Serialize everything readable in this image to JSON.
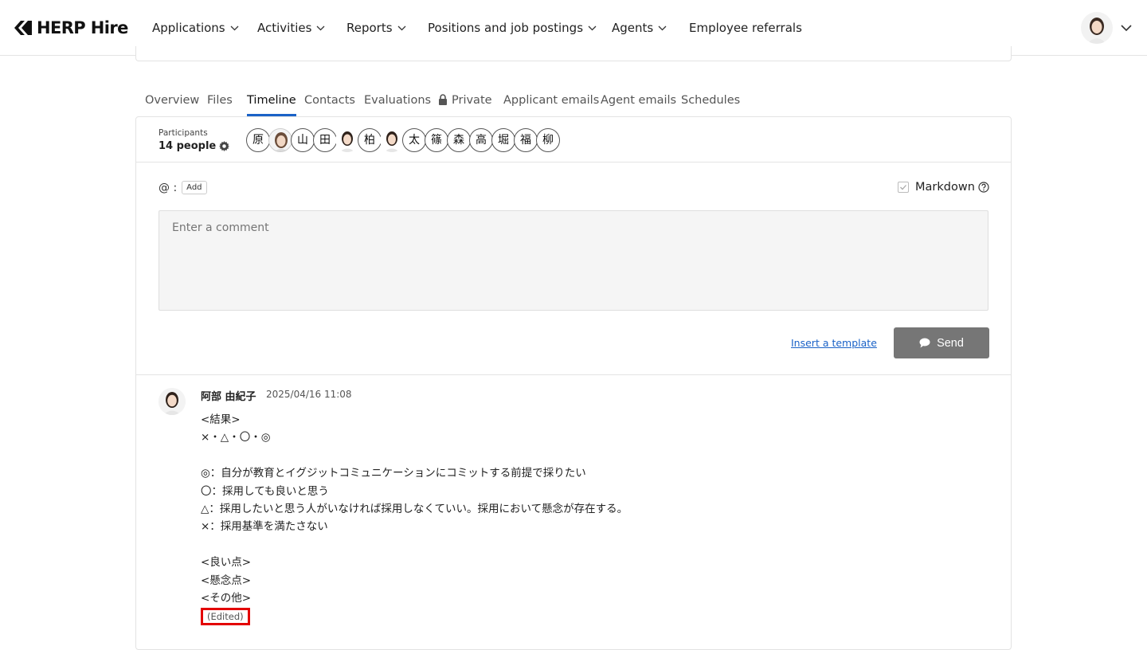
{
  "brand": {
    "name": "HERP Hire"
  },
  "nav": {
    "items": [
      {
        "label": "Applications",
        "dropdown": true,
        "active": true
      },
      {
        "label": "Activities",
        "dropdown": true
      },
      {
        "label": "Reports",
        "dropdown": true
      },
      {
        "label": "Positions and job postings",
        "dropdown": true
      },
      {
        "label": "Agents",
        "dropdown": true
      },
      {
        "label": "Employee referrals",
        "dropdown": false
      }
    ]
  },
  "tabs": [
    {
      "label": "Overview"
    },
    {
      "label": "Files"
    },
    {
      "label": "Timeline",
      "active": true
    },
    {
      "label": "Contacts"
    },
    {
      "label": "Evaluations"
    },
    {
      "label": "Private",
      "icon": "lock-icon"
    },
    {
      "label": "Applicant emails"
    },
    {
      "label": "Agent emails"
    },
    {
      "label": "Schedules"
    }
  ],
  "participants": {
    "label": "Participants",
    "count": "14 people",
    "avatars": [
      "原",
      "photo",
      "山",
      "田",
      "photo",
      "柏",
      "photo",
      "太",
      "篠",
      "森",
      "高",
      "堀",
      "福",
      "柳"
    ]
  },
  "composer": {
    "mention_prefix": "@ :",
    "add_label": "Add",
    "markdown_label": "Markdown",
    "placeholder": "Enter a comment",
    "template_link": "Insert a template",
    "send_label": "Send"
  },
  "post": {
    "author": "阿部 由紀子",
    "timestamp": "2025/04/16 11:08",
    "lines": [
      "<結果>",
      "×・△・〇・◎",
      "",
      "◎：自分が教育とイグジットコミュニケーションにコミットする前提で採りたい",
      "〇：採用しても良いと思う",
      "△：採用したいと思う人がいなければ採用しなくていい。採用において懸念が存在する。",
      "×：採用基準を満たさない",
      "",
      "<良い点>",
      "<懸念点>",
      "<その他>"
    ],
    "edited_label": "(Edited)"
  },
  "colors": {
    "accent": "#1a62c7",
    "send_button": "#767676",
    "highlight": "#e30000"
  }
}
